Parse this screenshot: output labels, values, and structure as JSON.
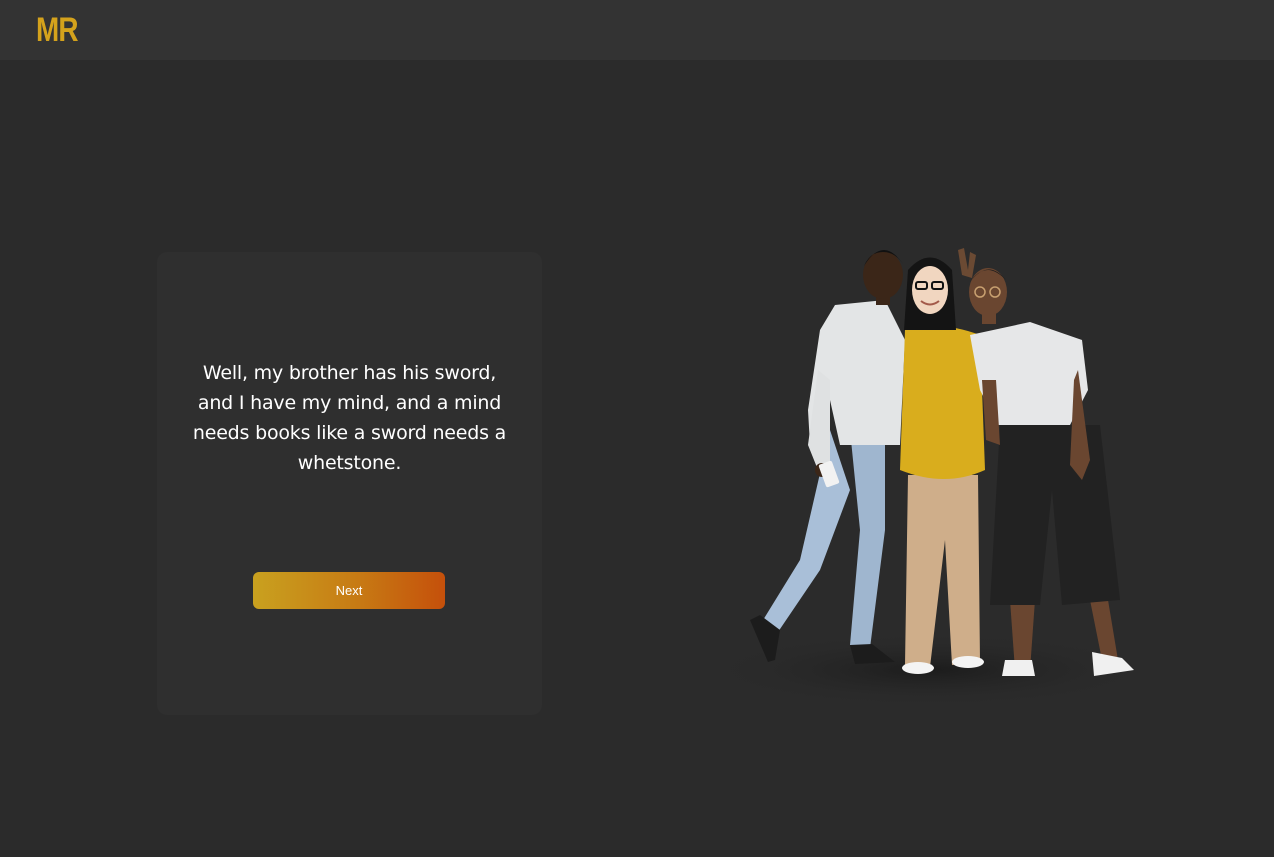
{
  "header": {
    "logo_text": "MR"
  },
  "card": {
    "quote": "Well, my brother has his sword, and I have my mind, and a mind needs books like a sword needs a whetstone.",
    "next_label": "Next"
  },
  "illustration": {
    "icon": "group-of-three-people-illustration"
  },
  "colors": {
    "background": "#2b2b2b",
    "topbar": "#333333",
    "card": "#2f2f2f",
    "brand": "#d4a21c",
    "button_start": "#c9a11f",
    "button_end": "#c5500b"
  }
}
